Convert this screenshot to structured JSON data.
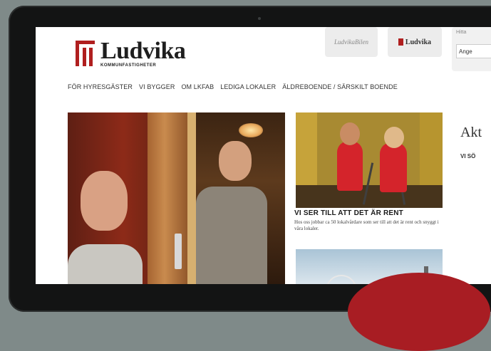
{
  "site": {
    "logo_name": "Ludvika",
    "logo_subtitle": "KOMMUNFASTIGHETER"
  },
  "partners": [
    {
      "label": "LudvikaBilen"
    },
    {
      "label": "Ludvika"
    }
  ],
  "side_panel": {
    "label": "Hitta",
    "field_value": "Ange"
  },
  "nav": {
    "items": [
      "FÖR HYRESGÄSTER",
      "VI BYGGER",
      "OM LKFAB",
      "LEDIGA LOKALER",
      "ÄLDREBOENDE / SÄRSKILT BOENDE"
    ]
  },
  "articles": [
    {
      "headline": "VI SER TILL ATT DET ÄR RENT",
      "description": "Hos oss jobbar ca 50 lokalvårdare som ser till att det är rent och snyggt i våra lokaler."
    }
  ],
  "sidebar": {
    "heading": "Akt",
    "teaser": "VI SÖ"
  }
}
